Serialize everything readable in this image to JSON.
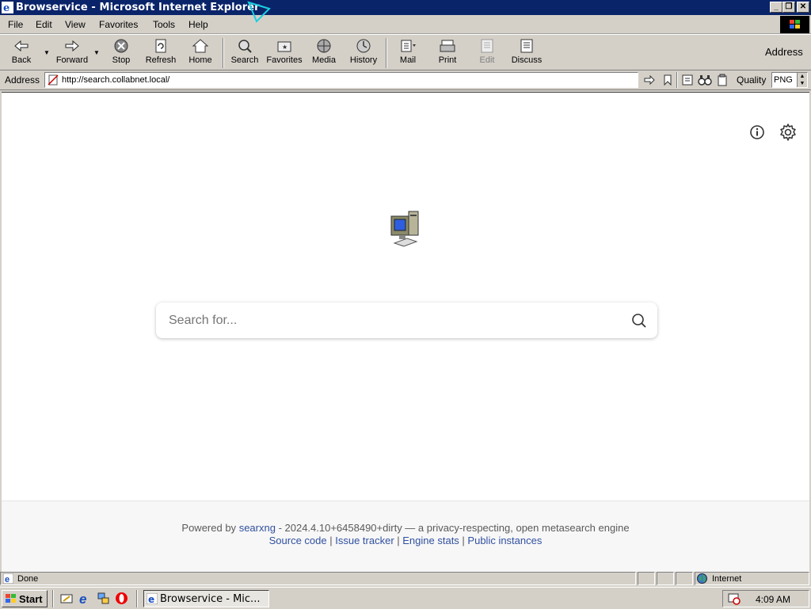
{
  "window": {
    "title": "Browservice - Microsoft Internet Explorer"
  },
  "menu": [
    "File",
    "Edit",
    "View",
    "Favorites",
    "Tools",
    "Help"
  ],
  "toolbar": {
    "back": "Back",
    "forward": "Forward",
    "stop": "Stop",
    "refresh": "Refresh",
    "home": "Home",
    "search": "Search",
    "favorites": "Favorites",
    "media": "Media",
    "history": "History",
    "mail": "Mail",
    "print": "Print",
    "edit": "Edit",
    "discuss": "Discuss",
    "address_label": "Address"
  },
  "address_bar": {
    "label": "Address",
    "url": "http://search.collabnet.local/",
    "quality_label": "Quality",
    "quality_value": "PNG"
  },
  "page": {
    "search_placeholder": "Search for...",
    "footer": {
      "powered_by": "Powered by",
      "engine_link": "searxng",
      "version_text": "- 2024.4.10+6458490+dirty — a privacy-respecting, open metasearch engine",
      "links": [
        "Source code",
        "Issue tracker",
        "Engine stats",
        "Public instances"
      ]
    }
  },
  "status_bar": {
    "status": "Done",
    "zone": "Internet"
  },
  "taskbar": {
    "start": "Start",
    "task": "Browservice - Mic...",
    "clock": "4:09 AM"
  },
  "icons": [
    "ie-icon",
    "back-icon",
    "forward-icon",
    "stop-icon",
    "refresh-icon",
    "home-icon",
    "search-icon",
    "favorites-icon",
    "media-icon",
    "history-icon",
    "mail-icon",
    "print-icon",
    "edit-icon",
    "discuss-icon",
    "info-icon",
    "gear-icon",
    "computer-logo-icon",
    "magnifier-icon",
    "globe-icon"
  ],
  "colors": {
    "titlebar": "#0a246a",
    "chrome": "#d4d0c8",
    "link": "#3050a0"
  }
}
